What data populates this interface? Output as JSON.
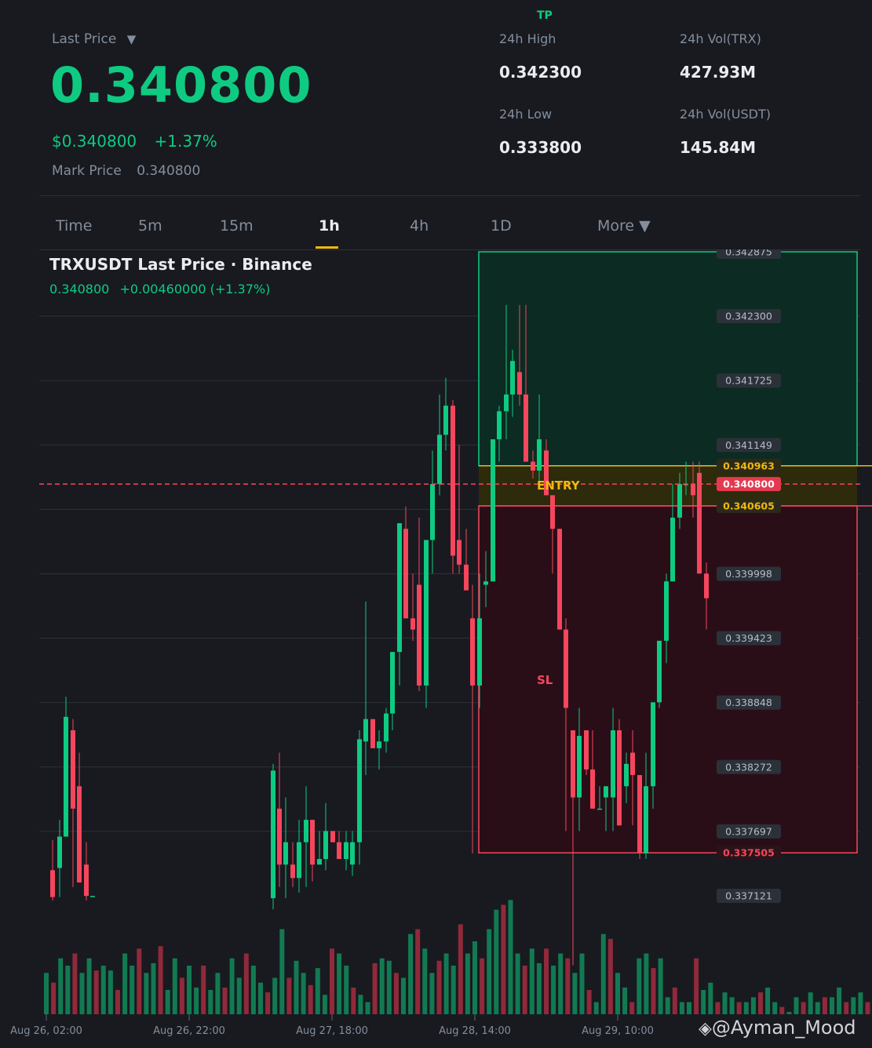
{
  "header": {
    "last_price_label": "Last Price",
    "last_price_caret": "▼",
    "last_price": "0.340800",
    "usd_price": "$0.340800",
    "change_pct": "+1.37%",
    "mark_price_label": "Mark Price",
    "mark_price": "0.340800",
    "tp_label": "TP",
    "stats": {
      "high_label": "24h High",
      "high": "0.342300",
      "low_label": "24h Low",
      "low": "0.333800",
      "vol_trx_label": "24h Vol(TRX)",
      "vol_trx": "427.93M",
      "vol_usdt_label": "24h Vol(USDT)",
      "vol_usdt": "145.84M"
    }
  },
  "tabs": [
    "Time",
    "5m",
    "15m",
    "1h",
    "4h",
    "1D",
    "More ▼"
  ],
  "active_tab": "1h",
  "chart": {
    "title": "TRXUSDT Last Price · Binance",
    "legend_price": "0.340800",
    "legend_change": "+0.00460000 (+1.37%)",
    "entry_label": "ENTRY",
    "sl_label": "SL",
    "watermark": "@Ayman_Mood",
    "colors": {
      "up": "#0ecb81",
      "down": "#f6465d",
      "entry": "#f0b90b",
      "tp_zone": "#0c2b22",
      "sl_zone": "#2a0e17",
      "bg": "#181a20"
    }
  },
  "chart_data": {
    "type": "candlestick",
    "title": "TRXUSDT Last Price · Binance",
    "price_axis_labels": [
      "0.342875",
      "0.342300",
      "0.341725",
      "0.341149",
      "0.340963",
      "0.340800",
      "0.340605",
      "0.339998",
      "0.339423",
      "0.338848",
      "0.338272",
      "0.337697",
      "0.337505",
      "0.337121"
    ],
    "grid_prices": [
      "0.342300",
      "0.341725",
      "0.341149",
      "0.340574",
      "0.339998",
      "0.339423",
      "0.338848",
      "0.338272",
      "0.337697"
    ],
    "x_ticks": [
      "Aug 26, 02:00",
      "Aug 26, 22:00",
      "Aug 27, 18:00",
      "Aug 28, 14:00",
      "Aug 29, 10:00"
    ],
    "current_price": 0.3408,
    "position": {
      "tp": 0.342875,
      "entry_high": 0.340963,
      "entry_low": 0.340605,
      "sl": 0.337505
    },
    "candles": [
      [
        0.33735,
        0.33762,
        0.33708,
        0.33711
      ],
      [
        0.33737,
        0.3378,
        0.33711,
        0.33765
      ],
      [
        0.33765,
        0.3389,
        0.33765,
        0.33872
      ],
      [
        0.3386,
        0.3387,
        0.3372,
        0.3379
      ],
      [
        0.3381,
        0.3384,
        0.3375,
        0.33724
      ],
      [
        0.3374,
        0.3376,
        0.33708,
        0.33712
      ],
      [
        0.33712,
        0.33712,
        0.33712,
        0.33712
      ],
      [
        0.3371,
        0.3383,
        0.337,
        0.33824
      ],
      [
        0.3379,
        0.3384,
        0.3372,
        0.3374
      ],
      [
        0.3374,
        0.338,
        0.3371,
        0.3376
      ],
      [
        0.3374,
        0.3376,
        0.3372,
        0.33728
      ],
      [
        0.33728,
        0.3378,
        0.33715,
        0.3376
      ],
      [
        0.3376,
        0.3381,
        0.3372,
        0.3378
      ],
      [
        0.3378,
        0.3376,
        0.33725,
        0.3374
      ],
      [
        0.3374,
        0.3377,
        0.3374,
        0.33745
      ],
      [
        0.33745,
        0.33795,
        0.33735,
        0.3377
      ],
      [
        0.3377,
        0.3377,
        0.3376,
        0.3376
      ],
      [
        0.3376,
        0.3377,
        0.33745,
        0.33745
      ],
      [
        0.33745,
        0.3377,
        0.33735,
        0.3376
      ],
      [
        0.3374,
        0.3377,
        0.3373,
        0.3376
      ],
      [
        0.3376,
        0.3386,
        0.3374,
        0.33852
      ],
      [
        0.3385,
        0.33975,
        0.3382,
        0.3387
      ],
      [
        0.3387,
        0.3387,
        0.33844,
        0.33844
      ],
      [
        0.33844,
        0.3386,
        0.33825,
        0.3385
      ],
      [
        0.3385,
        0.3388,
        0.3384,
        0.33875
      ],
      [
        0.33875,
        0.3393,
        0.3386,
        0.3393
      ],
      [
        0.3393,
        0.34045,
        0.339,
        0.34045
      ],
      [
        0.3404,
        0.3406,
        0.3399,
        0.3396
      ],
      [
        0.3396,
        0.34,
        0.3394,
        0.3395
      ],
      [
        0.3399,
        0.3405,
        0.33895,
        0.339
      ],
      [
        0.339,
        0.3402,
        0.3388,
        0.3403
      ],
      [
        0.3403,
        0.3411,
        0.34,
        0.3408
      ],
      [
        0.3408,
        0.3416,
        0.3407,
        0.34124
      ],
      [
        0.34124,
        0.34175,
        0.3411,
        0.3415
      ],
      [
        0.3415,
        0.34155,
        0.34,
        0.34016
      ],
      [
        0.3403,
        0.34115,
        0.34,
        0.34008
      ],
      [
        0.34008,
        0.3404,
        0.33995,
        0.33985
      ],
      [
        0.3396,
        0.3399,
        0.3375,
        0.339
      ],
      [
        0.339,
        0.34,
        0.3388,
        0.3396
      ],
      [
        0.3399,
        0.3402,
        0.3397,
        0.33993
      ],
      [
        0.33993,
        0.3412,
        0.33993,
        0.3412
      ],
      [
        0.3412,
        0.3415,
        0.341,
        0.34145
      ],
      [
        0.34145,
        0.3424,
        0.3412,
        0.3416
      ],
      [
        0.3416,
        0.342,
        0.3414,
        0.3419
      ],
      [
        0.3418,
        0.3424,
        0.3415,
        0.3416
      ],
      [
        0.3416,
        0.3424,
        0.3412,
        0.341
      ],
      [
        0.341,
        0.3411,
        0.34085,
        0.34092
      ],
      [
        0.34092,
        0.3416,
        0.3408,
        0.3412
      ],
      [
        0.3411,
        0.3412,
        0.3409,
        0.3407
      ],
      [
        0.3407,
        0.3406,
        0.34,
        0.3404
      ],
      [
        0.3404,
        0.3402,
        0.3395,
        0.3395
      ],
      [
        0.3395,
        0.3396,
        0.3377,
        0.3388
      ],
      [
        0.3386,
        0.3386,
        0.3365,
        0.338
      ],
      [
        0.338,
        0.3388,
        0.3377,
        0.33855
      ],
      [
        0.3386,
        0.3385,
        0.3382,
        0.33825
      ],
      [
        0.33825,
        0.3386,
        0.3381,
        0.3379
      ],
      [
        0.3379,
        0.3381,
        0.3379,
        0.3379
      ],
      [
        0.338,
        0.3381,
        0.3377,
        0.3381
      ],
      [
        0.338,
        0.3388,
        0.3377,
        0.3386
      ],
      [
        0.3386,
        0.3387,
        0.338,
        0.33775
      ],
      [
        0.3381,
        0.3384,
        0.33795,
        0.3383
      ],
      [
        0.3384,
        0.3386,
        0.33775,
        0.3382
      ],
      [
        0.3382,
        0.3382,
        0.33745,
        0.3375
      ],
      [
        0.3375,
        0.3384,
        0.33745,
        0.3381
      ],
      [
        0.3381,
        0.3388,
        0.3379,
        0.33885
      ],
      [
        0.33885,
        0.33915,
        0.3388,
        0.3394
      ],
      [
        0.3394,
        0.34,
        0.3392,
        0.33993
      ],
      [
        0.33993,
        0.3408,
        0.33993,
        0.3405
      ],
      [
        0.3405,
        0.3409,
        0.3404,
        0.3408
      ],
      [
        0.3408,
        0.341,
        0.3407,
        0.3408
      ],
      [
        0.3408,
        0.341,
        0.3405,
        0.3407
      ],
      [
        0.3409,
        0.341,
        0.34005,
        0.34
      ],
      [
        0.34,
        0.3401,
        0.3395,
        0.33978
      ],
      [
        0.33978,
        0.3401,
        0.33955,
        0.34
      ],
      [
        0.34,
        0.341,
        0.33995,
        0.3406
      ],
      [
        0.3406,
        0.3409,
        0.3405,
        0.3408
      ]
    ],
    "volumes": [
      52,
      48,
      58,
      55,
      60,
      52,
      58,
      53,
      55,
      53,
      45,
      60,
      55,
      62,
      52,
      56,
      63,
      45,
      58,
      50,
      55,
      46,
      55,
      45,
      52,
      46,
      58,
      50,
      60,
      55,
      48,
      44,
      50,
      70,
      50,
      57,
      52,
      47,
      54,
      43,
      62,
      60,
      55,
      46,
      43,
      40,
      56,
      58,
      57,
      52,
      50,
      68,
      70,
      62,
      52,
      57,
      60,
      55,
      72,
      60,
      65,
      58,
      70,
      78,
      80,
      82,
      60,
      55,
      62,
      56,
      62,
      55,
      60,
      58,
      52,
      60,
      45,
      40,
      68,
      66,
      52,
      46,
      40,
      58,
      60,
      54,
      58,
      42,
      46,
      40,
      40,
      58,
      45,
      48,
      40,
      44,
      42,
      40,
      40,
      42,
      44,
      46,
      40,
      38,
      36,
      42,
      40,
      44,
      40,
      42,
      42,
      46,
      40,
      42,
      44,
      40,
      42,
      45,
      40,
      42
    ],
    "volume_colors": "alternating up/down per candle"
  }
}
